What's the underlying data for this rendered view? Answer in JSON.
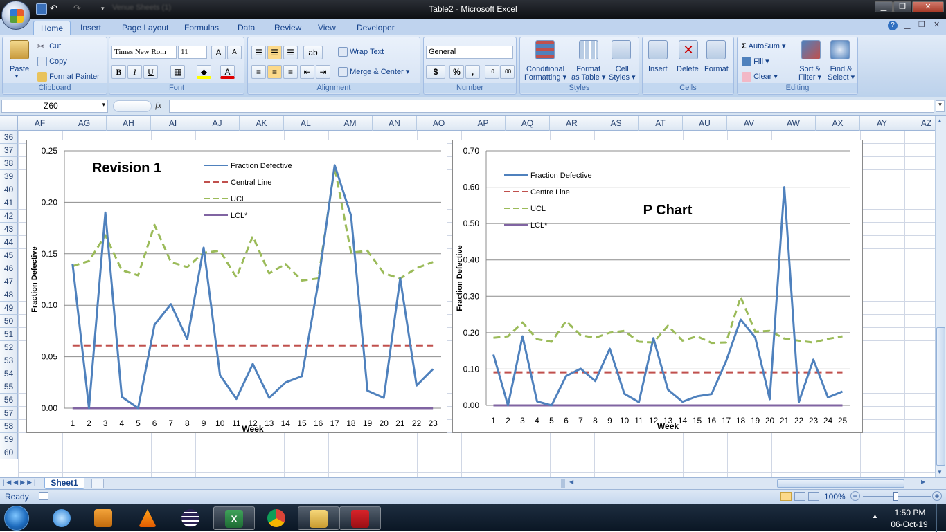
{
  "window": {
    "title": "Table2 - Microsoft Excel",
    "qat_placeholder": "Venue Sheets (1)"
  },
  "ribbon_tabs": [
    "Home",
    "Insert",
    "Page Layout",
    "Formulas",
    "Data",
    "Review",
    "View",
    "Developer"
  ],
  "clipboard": {
    "paste": "Paste",
    "cut": "Cut",
    "copy": "Copy",
    "format_painter": "Format Painter",
    "label": "Clipboard"
  },
  "font": {
    "family": "Times New Rom",
    "size": "11",
    "bold": "B",
    "italic": "I",
    "underline": "U",
    "label": "Font"
  },
  "alignment": {
    "wrap": "Wrap Text",
    "merge": "Merge & Center",
    "label": "Alignment"
  },
  "number": {
    "format": "General",
    "currency": "$",
    "percent": "%",
    "comma": ",",
    "label": "Number"
  },
  "styles": {
    "cond1": "Conditional",
    "cond2": "Formatting",
    "fmt1": "Format",
    "fmt2": "as Table",
    "cell1": "Cell",
    "cell2": "Styles",
    "label": "Styles"
  },
  "cells": {
    "insert": "Insert",
    "delete": "Delete",
    "format": "Format",
    "label": "Cells"
  },
  "editing": {
    "autosum": "AutoSum",
    "fill": "Fill",
    "clear": "Clear",
    "sort1": "Sort &",
    "sort2": "Filter",
    "find1": "Find &",
    "find2": "Select",
    "label": "Editing"
  },
  "formula_bar": {
    "name_box": "Z60",
    "fx": "fx",
    "formula": ""
  },
  "columns": [
    "AF",
    "AG",
    "AH",
    "AI",
    "AJ",
    "AK",
    "AL",
    "AM",
    "AN",
    "AO",
    "AP",
    "AQ",
    "AR",
    "AS",
    "AT",
    "AU",
    "AV",
    "AW",
    "AX",
    "AY",
    "AZ"
  ],
  "rows": [
    "36",
    "37",
    "38",
    "39",
    "40",
    "41",
    "42",
    "43",
    "44",
    "45",
    "46",
    "47",
    "48",
    "49",
    "50",
    "51",
    "52",
    "53",
    "54",
    "55",
    "56",
    "57",
    "58",
    "59",
    "60"
  ],
  "sheet": {
    "tab": "Sheet1"
  },
  "status": {
    "ready": "Ready",
    "zoom": "100%"
  },
  "taskbar": {
    "time": "1:50 PM",
    "date": "06-Oct-19"
  },
  "chart_data": [
    {
      "type": "line",
      "title": "Revision 1",
      "xlabel": "Week",
      "ylabel": "Fraction Defective",
      "ylim": [
        0,
        0.25
      ],
      "yticks": [
        "0.00",
        "0.05",
        "0.10",
        "0.15",
        "0.20",
        "0.25"
      ],
      "categories": [
        1,
        2,
        3,
        4,
        5,
        6,
        7,
        8,
        9,
        10,
        11,
        12,
        13,
        14,
        15,
        16,
        17,
        18,
        19,
        20,
        21,
        22,
        23
      ],
      "legend_position": "top",
      "grid": "horizontal",
      "series": [
        {
          "name": "Fraction Defective",
          "color": "#4f81bd",
          "style": "solid",
          "values": [
            0.14,
            0.0,
            0.19,
            0.011,
            0.0,
            0.081,
            0.101,
            0.067,
            0.156,
            0.032,
            0.009,
            0.043,
            0.01,
            0.025,
            0.031,
            0.122,
            0.236,
            0.187,
            0.017,
            0.01,
            0.126,
            0.022,
            0.038
          ]
        },
        {
          "name": "Central Line",
          "color": "#c0504d",
          "style": "dashed",
          "values": [
            0.061,
            0.061,
            0.061,
            0.061,
            0.061,
            0.061,
            0.061,
            0.061,
            0.061,
            0.061,
            0.061,
            0.061,
            0.061,
            0.061,
            0.061,
            0.061,
            0.061,
            0.061,
            0.061,
            0.061,
            0.061,
            0.061,
            0.061
          ]
        },
        {
          "name": "UCL",
          "color": "#9bbb59",
          "style": "dashed",
          "values": [
            0.138,
            0.143,
            0.168,
            0.134,
            0.129,
            0.178,
            0.142,
            0.137,
            0.151,
            0.153,
            0.127,
            0.167,
            0.131,
            0.14,
            0.124,
            0.126,
            0.234,
            0.151,
            0.153,
            0.131,
            0.126,
            0.136,
            0.142
          ]
        },
        {
          "name": "LCL*",
          "color": "#8064a2",
          "style": "solid",
          "values": [
            0,
            0,
            0,
            0,
            0,
            0,
            0,
            0,
            0,
            0,
            0,
            0,
            0,
            0,
            0,
            0,
            0,
            0,
            0,
            0,
            0,
            0,
            0
          ]
        }
      ]
    },
    {
      "type": "line",
      "title": "P Chart",
      "xlabel": "Week",
      "ylabel": "Fraction Defective",
      "ylim": [
        0,
        0.7
      ],
      "yticks": [
        "0.00",
        "0.10",
        "0.20",
        "0.30",
        "0.40",
        "0.50",
        "0.60",
        "0.70"
      ],
      "categories": [
        1,
        2,
        3,
        4,
        5,
        6,
        7,
        8,
        9,
        10,
        11,
        12,
        13,
        14,
        15,
        16,
        17,
        18,
        19,
        20,
        21,
        22,
        23,
        24,
        25
      ],
      "legend_position": "top-left",
      "grid": "horizontal",
      "series": [
        {
          "name": "Fraction Defective",
          "color": "#4f81bd",
          "style": "solid",
          "values": [
            0.14,
            0.0,
            0.19,
            0.011,
            0.0,
            0.081,
            0.101,
            0.067,
            0.156,
            0.032,
            0.009,
            0.185,
            0.043,
            0.01,
            0.025,
            0.031,
            0.122,
            0.236,
            0.187,
            0.017,
            0.6,
            0.009,
            0.126,
            0.022,
            0.038
          ]
        },
        {
          "name": "Centre Line",
          "color": "#c0504d",
          "style": "dashed",
          "values": [
            0.091,
            0.091,
            0.091,
            0.091,
            0.091,
            0.091,
            0.091,
            0.091,
            0.091,
            0.091,
            0.091,
            0.091,
            0.091,
            0.091,
            0.091,
            0.091,
            0.091,
            0.091,
            0.091,
            0.091,
            0.091,
            0.091,
            0.091,
            0.091,
            0.091
          ]
        },
        {
          "name": "UCL",
          "color": "#9bbb59",
          "style": "dashed",
          "values": [
            0.186,
            0.19,
            0.228,
            0.182,
            0.175,
            0.232,
            0.193,
            0.186,
            0.2,
            0.205,
            0.175,
            0.173,
            0.219,
            0.178,
            0.19,
            0.172,
            0.173,
            0.298,
            0.203,
            0.205,
            0.184,
            0.178,
            0.173,
            0.183,
            0.19
          ]
        },
        {
          "name": "LCL*",
          "color": "#8064a2",
          "style": "solid",
          "values": [
            0,
            0,
            0,
            0,
            0,
            0,
            0,
            0,
            0,
            0,
            0,
            0,
            0,
            0,
            0,
            0,
            0,
            0,
            0,
            0,
            0,
            0,
            0,
            0,
            0
          ]
        }
      ]
    }
  ]
}
